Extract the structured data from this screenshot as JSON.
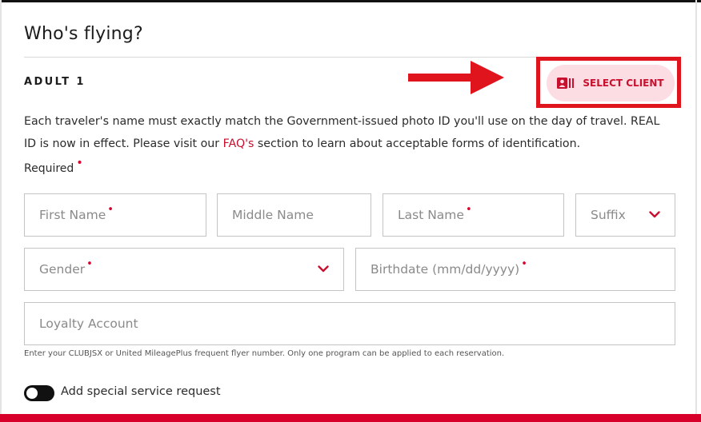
{
  "form": {
    "title": "Who's flying?",
    "section_label": "ADULT 1",
    "select_client_label": "SELECT CLIENT",
    "description_part1": "Each traveler's name must exactly match the Government-issued photo ID you'll use on the day of travel. REAL ID is now in effect. Please visit our ",
    "faq_link": "FAQ's",
    "description_part2": " section to learn about acceptable forms of identification.",
    "required_label": "Required",
    "required_marker": "•"
  },
  "fields": {
    "first_name": {
      "placeholder": "First Name",
      "required": true
    },
    "middle_name": {
      "placeholder": "Middle Name",
      "required": false
    },
    "last_name": {
      "placeholder": "Last Name",
      "required": true
    },
    "suffix": {
      "placeholder": "Suffix",
      "type": "select"
    },
    "gender": {
      "placeholder": "Gender",
      "required": true,
      "type": "select"
    },
    "birthdate": {
      "placeholder": "Birthdate (mm/dd/yyyy)",
      "required": true
    },
    "loyalty": {
      "placeholder": "Loyalty Account"
    }
  },
  "loyalty_hint": "Enter your CLUBJSX or United MileagePlus frequent flyer number. Only one program can be applied to each reservation.",
  "special_service": {
    "label": "Add special service request",
    "enabled": false
  },
  "colors": {
    "accent": "#c8102e",
    "highlight_box": "#e0141c",
    "button_bg": "#fcdde3",
    "footer_bar": "#d6002a"
  },
  "icons": {
    "select_client_icon": "id-card-icon",
    "dropdown_icon": "chevron-down-icon",
    "annotation_icon": "arrow-right-icon"
  }
}
